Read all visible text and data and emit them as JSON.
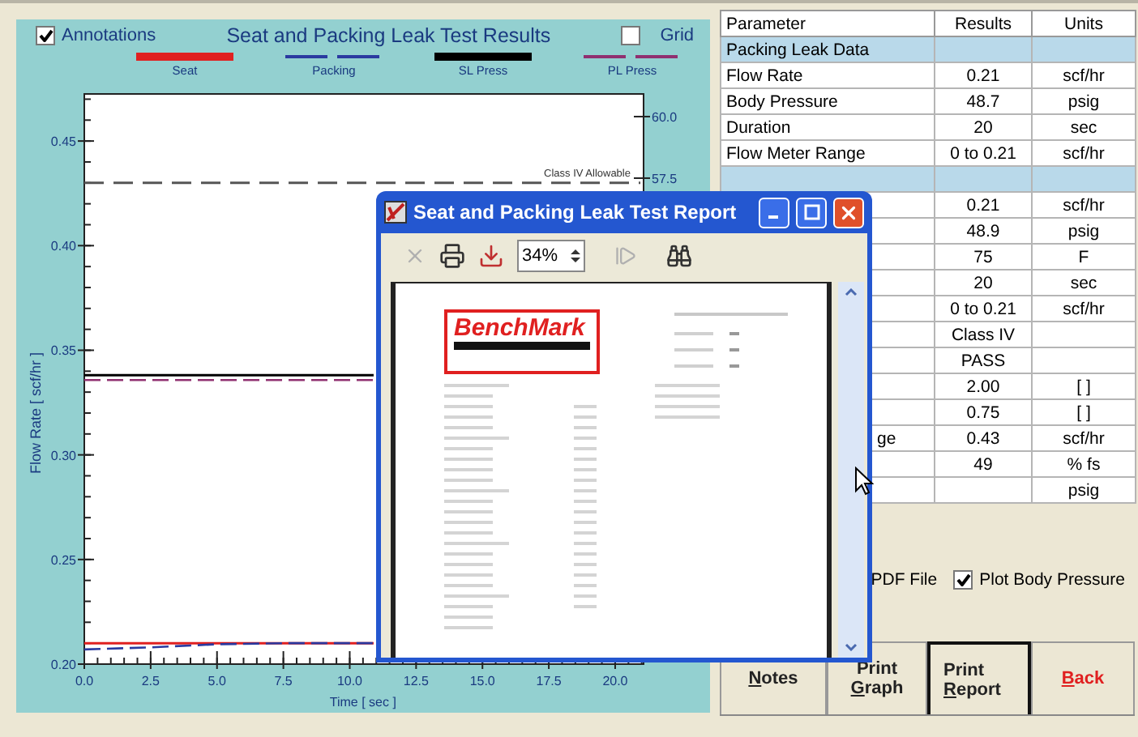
{
  "chart_panel": {
    "annotations_toggle": {
      "label": "Annotations",
      "checked": true
    },
    "grid_toggle": {
      "label": "Grid",
      "checked": false
    },
    "chart_data": {
      "type": "line",
      "title": "Seat and Packing Leak Test Results",
      "xlabel": "Time [ sec ]",
      "ylabel": "Flow Rate [ scf/hr ]",
      "x": [
        0,
        2.5,
        5,
        7.5,
        10,
        10.9,
        20.95
      ],
      "xlim": [
        0,
        21.07
      ],
      "ylim": [
        0.2,
        0.4725
      ],
      "y2lim": [
        37.76,
        60.92
      ],
      "xticks": [
        {
          "value": 0,
          "label": "0.0"
        },
        {
          "value": 2.5,
          "label": "2.5"
        },
        {
          "value": 5,
          "label": "5.0"
        },
        {
          "value": 7.5,
          "label": "7.5"
        },
        {
          "value": 10,
          "label": "10.0"
        },
        {
          "value": 12.5,
          "label": "12.5"
        },
        {
          "value": 15,
          "label": "15.0"
        },
        {
          "value": 17.5,
          "label": "17.5"
        },
        {
          "value": 20,
          "label": "20.0"
        }
      ],
      "yticks": [
        {
          "value": 0.2,
          "label": "0.20"
        },
        {
          "value": 0.25,
          "label": "0.25"
        },
        {
          "value": 0.3,
          "label": "0.30"
        },
        {
          "value": 0.35,
          "label": "0.35"
        },
        {
          "value": 0.4,
          "label": "0.40"
        },
        {
          "value": 0.45,
          "label": "0.45"
        }
      ],
      "y2ticks": [
        {
          "value": 57.5,
          "label": "57.5"
        },
        {
          "value": 60,
          "label": "60.0"
        }
      ],
      "series": [
        {
          "name": "Seat",
          "color": "#e02020",
          "line_style": "solid",
          "axis": "y",
          "values": [
            0.21,
            0.21,
            0.21,
            0.21,
            0.21,
            0.21,
            null
          ]
        },
        {
          "name": "Packing",
          "color": "#2a3aa0",
          "line_style": "dashed",
          "axis": "y",
          "values": [
            0.207,
            0.208,
            0.2095,
            0.21,
            0.21,
            0.21,
            null
          ]
        },
        {
          "name": "SL Press",
          "color": "#000000",
          "line_style": "solid",
          "axis": "y2",
          "values": [
            49.5,
            49.5,
            49.5,
            49.5,
            49.5,
            49.5,
            null
          ]
        },
        {
          "name": "PL Press",
          "color": "#903070",
          "line_style": "dashed",
          "axis": "y2",
          "values": [
            49.3,
            49.3,
            49.3,
            49.3,
            49.3,
            49.3,
            null
          ]
        },
        {
          "name": "Class IV Allowable",
          "color": "#555555",
          "line_style": "dashed",
          "values": [
            0.43,
            0.43,
            0.43,
            0.43,
            0.43,
            0.43,
            0.43
          ]
        }
      ]
    }
  },
  "results_table": {
    "columns": [
      "Parameter",
      "Results",
      "Units"
    ],
    "rows": [
      {
        "kind": "section",
        "param": "Packing Leak Data"
      },
      {
        "kind": "data",
        "param": "Flow Rate",
        "result": "0.21",
        "units": "scf/hr"
      },
      {
        "kind": "data",
        "param": "Body Pressure",
        "result": "48.7",
        "units": "psig"
      },
      {
        "kind": "data",
        "param": "Duration",
        "result": "20",
        "units": "sec"
      },
      {
        "kind": "data",
        "param": "Flow Meter Range",
        "result": "0 to 0.21",
        "units": "scf/hr"
      },
      {
        "kind": "section"
      },
      {
        "kind": "data",
        "result": "0.21",
        "units": "scf/hr"
      },
      {
        "kind": "data",
        "result": "48.9",
        "units": "psig"
      },
      {
        "kind": "data",
        "result": "75",
        "units": "F"
      },
      {
        "kind": "data",
        "result": "20",
        "units": "sec"
      },
      {
        "kind": "data",
        "result": "0 to 0.21",
        "units": "scf/hr"
      },
      {
        "kind": "data",
        "result": "Class IV"
      },
      {
        "kind": "data",
        "result": "PASS"
      },
      {
        "kind": "data",
        "result": "2.00",
        "units": "[ ]"
      },
      {
        "kind": "data",
        "result": "0.75",
        "units": "[ ]"
      },
      {
        "kind": "cut",
        "param": "ge",
        "result": "0.43",
        "units": "scf/hr"
      },
      {
        "kind": "data",
        "result": "49",
        "units": "% fs"
      },
      {
        "kind": "data",
        "units": "psig"
      }
    ]
  },
  "options": [
    {
      "kind": "label",
      "label": "PDF File"
    },
    {
      "kind": "checkbox",
      "label": "Plot Body Pressure",
      "checked": true
    }
  ],
  "buttons": [
    {
      "lines": [
        "Notes"
      ],
      "focused": false,
      "kind": "normal"
    },
    {
      "lines": [
        "Print",
        "Graph"
      ],
      "focused": false,
      "kind": "normal"
    },
    {
      "lines": [
        "Print",
        "Report"
      ],
      "focused": true,
      "kind": "normal"
    },
    {
      "lines": [
        "Back"
      ],
      "focused": false,
      "kind": "danger"
    }
  ],
  "report_dialog": {
    "title": "Seat and Packing Leak Test Report",
    "tools": [
      {
        "kind": "cross",
        "disabled": true
      },
      {
        "kind": "printer",
        "disabled": false
      },
      {
        "kind": "export",
        "disabled": false
      },
      {
        "kind": "zoom",
        "value": "34%"
      },
      {
        "kind": "next",
        "disabled": true
      },
      {
        "kind": "find",
        "disabled": false
      }
    ],
    "logo": "BenchMark"
  }
}
